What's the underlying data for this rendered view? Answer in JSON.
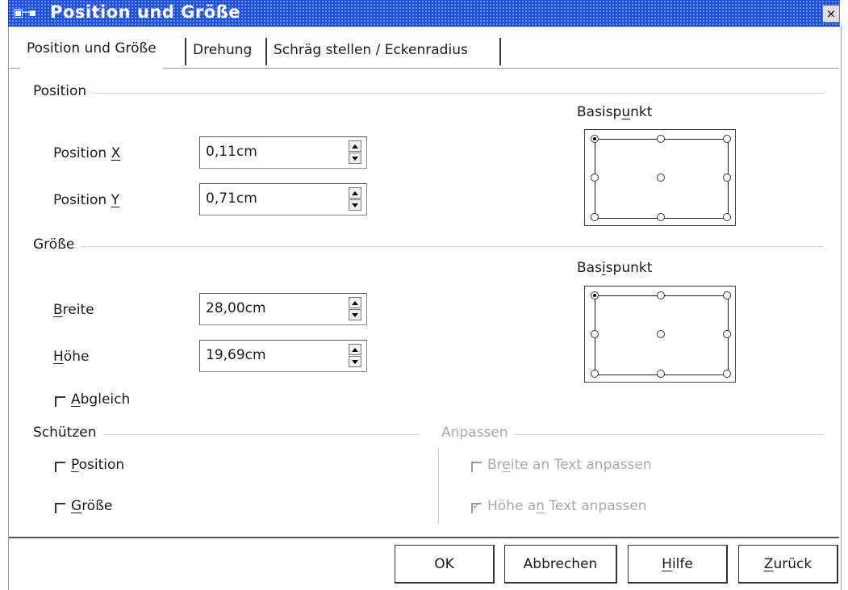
{
  "window": {
    "title": "Position und Größe",
    "close_glyph": "×"
  },
  "tabs": [
    {
      "label": "Position und Größe",
      "active": true
    },
    {
      "label": "Drehung",
      "active": false
    },
    {
      "label": "Schräg stellen / Eckenradius",
      "active": false
    }
  ],
  "position": {
    "group_label": "Position",
    "x_label": "Position X",
    "x_value": "0,11cm",
    "y_label": "Position Y",
    "y_value": "0,71cm",
    "basis_label": "Basispunkt"
  },
  "size": {
    "group_label": "Größe",
    "width_label": "Breite",
    "width_value": "28,00cm",
    "height_label": "Höhe",
    "height_value": "19,69cm",
    "keep_ratio_label": "Abgleich",
    "keep_ratio_checked": false,
    "basis_label": "Basispunkt"
  },
  "protect": {
    "group_label": "Schützen",
    "position_label": "Position",
    "size_label": "Größe"
  },
  "adapt": {
    "group_label": "Anpassen",
    "fit_width_label": "Breite an Text anpassen",
    "fit_width_checked": false,
    "fit_height_label": "Höhe an Text anpassen",
    "fit_height_checked": true
  },
  "buttons": {
    "ok": "OK",
    "cancel": "Abbrechen",
    "help": "Hilfe",
    "reset": "Zurück"
  },
  "icons": [
    "window-menu-icon",
    "pin-icon",
    "close-icon",
    "spin-up-icon",
    "spin-down-icon",
    "checkbox-icon",
    "radio-icon"
  ]
}
